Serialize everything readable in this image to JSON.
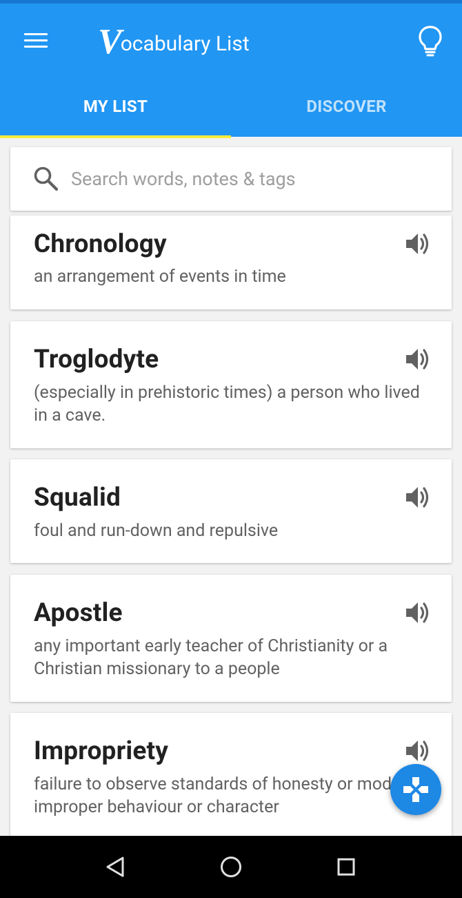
{
  "colors": {
    "primary": "#2196f3",
    "primary_dark": "#1976d2",
    "tab_indicator": "#ffeb3b",
    "fab": "#1e88e5",
    "background": "#f2f2f2"
  },
  "toolbar": {
    "logo_letter": "V",
    "title_rest": "ocabulary List",
    "menu_icon": "hamburger-menu-icon",
    "tip_icon": "lightbulb-icon"
  },
  "tabs": [
    {
      "label": "MY LIST",
      "active": true
    },
    {
      "label": "DISCOVER",
      "active": false
    }
  ],
  "search": {
    "placeholder": "Search words, notes & tags",
    "value": "",
    "icon": "search-icon"
  },
  "words": [
    {
      "word": "Chronology",
      "definition": "an arrangement of events in time"
    },
    {
      "word": "Troglodyte",
      "definition": "(especially in prehistoric times) a person who lived in a cave."
    },
    {
      "word": "Squalid",
      "definition": "foul and run-down and repulsive"
    },
    {
      "word": "Apostle",
      "definition": "any important early teacher of Christianity or a Christian missionary to a people"
    },
    {
      "word": "Impropriety",
      "definition": "failure to observe standards of honesty or modesty; improper behaviour or character"
    }
  ],
  "fab": {
    "icon": "gamepad-icon"
  },
  "navbar": {
    "back_icon": "back-triangle-icon",
    "home_icon": "home-circle-icon",
    "recents_icon": "recents-square-icon"
  }
}
